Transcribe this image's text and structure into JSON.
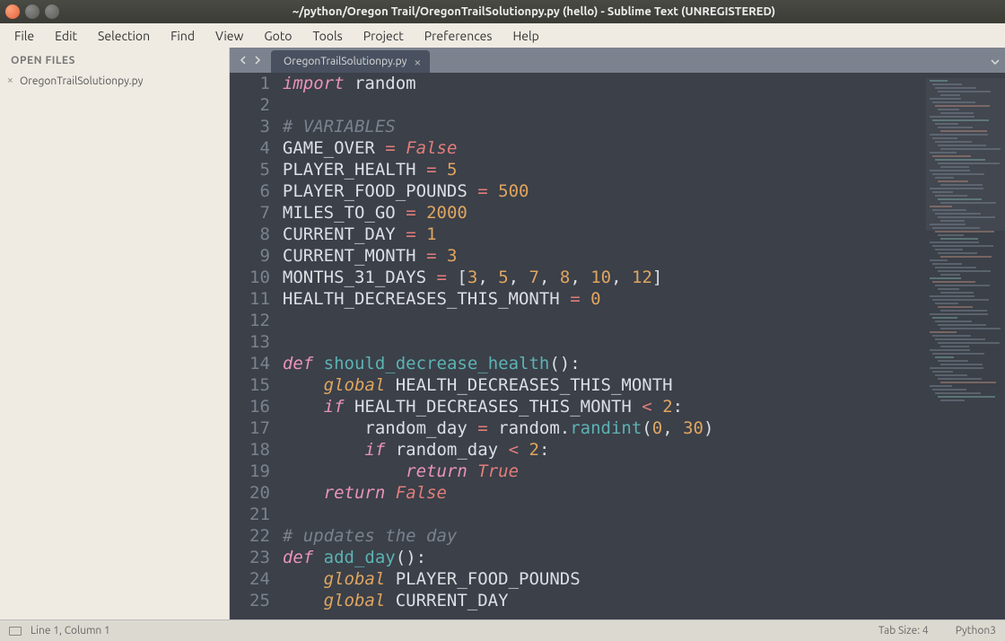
{
  "window": {
    "title": "~/python/Oregon Trail/OregonTrailSolutionpy.py (hello) - Sublime Text (UNREGISTERED)"
  },
  "menubar": {
    "items": [
      "File",
      "Edit",
      "Selection",
      "Find",
      "View",
      "Goto",
      "Tools",
      "Project",
      "Preferences",
      "Help"
    ]
  },
  "sidebar": {
    "header": "OPEN FILES",
    "files": [
      "OregonTrailSolutionpy.py"
    ]
  },
  "tabs": {
    "active": "OregonTrailSolutionpy.py"
  },
  "code": {
    "lines": [
      [
        {
          "t": "import",
          "c": "kw-import"
        },
        {
          "t": " ",
          "c": ""
        },
        {
          "t": "random",
          "c": "id"
        }
      ],
      [],
      [
        {
          "t": "# VARIABLES",
          "c": "cmt"
        }
      ],
      [
        {
          "t": "GAME_OVER",
          "c": "var"
        },
        {
          "t": " ",
          "c": ""
        },
        {
          "t": "=",
          "c": "op"
        },
        {
          "t": " ",
          "c": ""
        },
        {
          "t": "False",
          "c": "cnst"
        }
      ],
      [
        {
          "t": "PLAYER_HEALTH",
          "c": "var"
        },
        {
          "t": " ",
          "c": ""
        },
        {
          "t": "=",
          "c": "op"
        },
        {
          "t": " ",
          "c": ""
        },
        {
          "t": "5",
          "c": "num"
        }
      ],
      [
        {
          "t": "PLAYER_FOOD_POUNDS",
          "c": "var"
        },
        {
          "t": " ",
          "c": ""
        },
        {
          "t": "=",
          "c": "op"
        },
        {
          "t": " ",
          "c": ""
        },
        {
          "t": "500",
          "c": "num"
        }
      ],
      [
        {
          "t": "MILES_TO_GO",
          "c": "var"
        },
        {
          "t": " ",
          "c": ""
        },
        {
          "t": "=",
          "c": "op"
        },
        {
          "t": " ",
          "c": ""
        },
        {
          "t": "2000",
          "c": "num"
        }
      ],
      [
        {
          "t": "CURRENT_DAY",
          "c": "var"
        },
        {
          "t": " ",
          "c": ""
        },
        {
          "t": "=",
          "c": "op"
        },
        {
          "t": " ",
          "c": ""
        },
        {
          "t": "1",
          "c": "num"
        }
      ],
      [
        {
          "t": "CURRENT_MONTH",
          "c": "var"
        },
        {
          "t": " ",
          "c": ""
        },
        {
          "t": "=",
          "c": "op"
        },
        {
          "t": " ",
          "c": ""
        },
        {
          "t": "3",
          "c": "num"
        }
      ],
      [
        {
          "t": "MONTHS_31_DAYS",
          "c": "var"
        },
        {
          "t": " ",
          "c": ""
        },
        {
          "t": "=",
          "c": "op"
        },
        {
          "t": " ",
          "c": ""
        },
        {
          "t": "[",
          "c": "punc"
        },
        {
          "t": "3",
          "c": "num"
        },
        {
          "t": ", ",
          "c": "punc"
        },
        {
          "t": "5",
          "c": "num"
        },
        {
          "t": ", ",
          "c": "punc"
        },
        {
          "t": "7",
          "c": "num"
        },
        {
          "t": ", ",
          "c": "punc"
        },
        {
          "t": "8",
          "c": "num"
        },
        {
          "t": ", ",
          "c": "punc"
        },
        {
          "t": "10",
          "c": "num"
        },
        {
          "t": ", ",
          "c": "punc"
        },
        {
          "t": "12",
          "c": "num"
        },
        {
          "t": "]",
          "c": "punc"
        }
      ],
      [
        {
          "t": "HEALTH_DECREASES_THIS_MONTH",
          "c": "var"
        },
        {
          "t": " ",
          "c": ""
        },
        {
          "t": "=",
          "c": "op"
        },
        {
          "t": " ",
          "c": ""
        },
        {
          "t": "0",
          "c": "num"
        }
      ],
      [],
      [],
      [
        {
          "t": "def",
          "c": "kw"
        },
        {
          "t": " ",
          "c": ""
        },
        {
          "t": "should_decrease_health",
          "c": "fn"
        },
        {
          "t": "():",
          "c": "punc"
        }
      ],
      [
        {
          "t": "    ",
          "c": ""
        },
        {
          "t": "global",
          "c": "kw-storage"
        },
        {
          "t": " HEALTH_DECREASES_THIS_MONTH",
          "c": "var"
        }
      ],
      [
        {
          "t": "    ",
          "c": ""
        },
        {
          "t": "if",
          "c": "kw"
        },
        {
          "t": " HEALTH_DECREASES_THIS_MONTH ",
          "c": "var"
        },
        {
          "t": "<",
          "c": "op"
        },
        {
          "t": " ",
          "c": ""
        },
        {
          "t": "2",
          "c": "num"
        },
        {
          "t": ":",
          "c": "punc"
        }
      ],
      [
        {
          "t": "        random_day ",
          "c": "var"
        },
        {
          "t": "=",
          "c": "op"
        },
        {
          "t": " random",
          "c": "var"
        },
        {
          "t": ".",
          "c": "punc"
        },
        {
          "t": "randint",
          "c": "fn"
        },
        {
          "t": "(",
          "c": "punc"
        },
        {
          "t": "0",
          "c": "num"
        },
        {
          "t": ", ",
          "c": "punc"
        },
        {
          "t": "30",
          "c": "num"
        },
        {
          "t": ")",
          "c": "punc"
        }
      ],
      [
        {
          "t": "        ",
          "c": ""
        },
        {
          "t": "if",
          "c": "kw"
        },
        {
          "t": " random_day ",
          "c": "var"
        },
        {
          "t": "<",
          "c": "op"
        },
        {
          "t": " ",
          "c": ""
        },
        {
          "t": "2",
          "c": "num"
        },
        {
          "t": ":",
          "c": "punc"
        }
      ],
      [
        {
          "t": "            ",
          "c": ""
        },
        {
          "t": "return",
          "c": "kw"
        },
        {
          "t": " ",
          "c": ""
        },
        {
          "t": "True",
          "c": "cnst"
        }
      ],
      [
        {
          "t": "    ",
          "c": ""
        },
        {
          "t": "return",
          "c": "kw"
        },
        {
          "t": " ",
          "c": ""
        },
        {
          "t": "False",
          "c": "cnst"
        }
      ],
      [],
      [
        {
          "t": "# updates the day",
          "c": "cmt"
        }
      ],
      [
        {
          "t": "def",
          "c": "kw"
        },
        {
          "t": " ",
          "c": ""
        },
        {
          "t": "add_day",
          "c": "fn"
        },
        {
          "t": "():",
          "c": "punc"
        }
      ],
      [
        {
          "t": "    ",
          "c": ""
        },
        {
          "t": "global",
          "c": "kw-storage"
        },
        {
          "t": " PLAYER_FOOD_POUNDS",
          "c": "var"
        }
      ],
      [
        {
          "t": "    ",
          "c": ""
        },
        {
          "t": "global",
          "c": "kw-storage"
        },
        {
          "t": " CURRENT_DAY",
          "c": "var"
        }
      ]
    ]
  },
  "statusbar": {
    "position": "Line 1, Column 1",
    "tab_size": "Tab Size: 4",
    "syntax": "Python3"
  }
}
